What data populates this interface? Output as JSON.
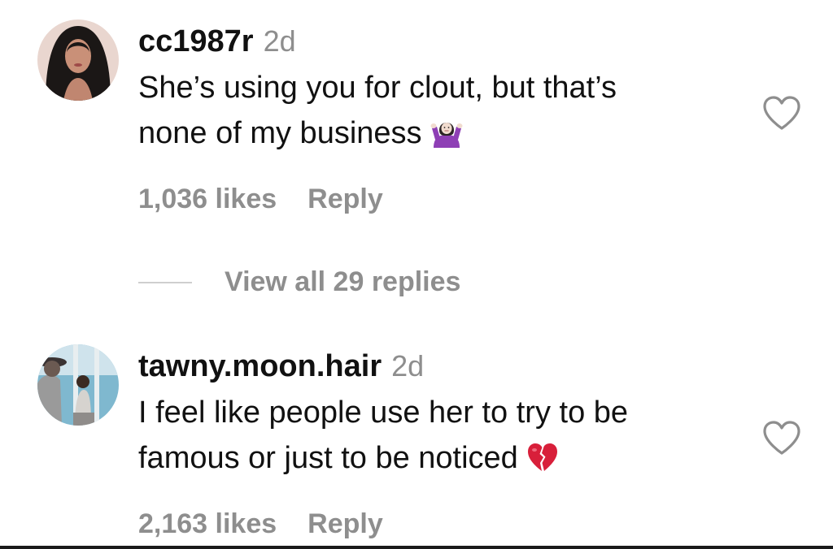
{
  "comments": [
    {
      "username": "cc1987r",
      "time": "2d",
      "text_line1": "She’s using you for clout, but that’s",
      "text_line2": "none of my business",
      "emoji": "person-shrugging-emoji",
      "likes": "1,036 likes",
      "reply_label": "Reply",
      "liked": false
    },
    {
      "username": "tawny.moon.hair",
      "time": "2d",
      "text_line1": "I feel like people use her to try to be",
      "text_line2": "famous or just to be noticed",
      "emoji": "broken-heart-emoji",
      "likes": "2,163 likes",
      "reply_label": "Reply",
      "liked": false
    }
  ],
  "view_replies": {
    "label": "View all 29 replies"
  },
  "colors": {
    "text": "#111111",
    "secondary": "#8e8e8e",
    "divider": "#cfcfcf",
    "broken_heart": "#d81f3a",
    "shrug_shirt": "#8e3fb5"
  }
}
